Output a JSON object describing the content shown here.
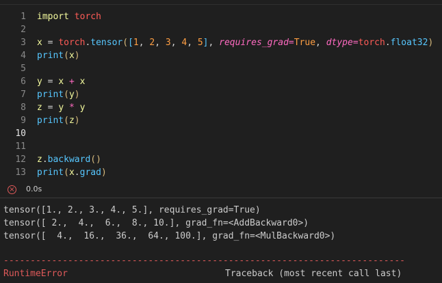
{
  "code_cell": {
    "lines": [
      {
        "num": "1",
        "tokens": [
          {
            "t": "import ",
            "c": "kw"
          },
          {
            "t": "torch",
            "c": "mod"
          }
        ]
      },
      {
        "num": "2",
        "tokens": []
      },
      {
        "num": "3",
        "tokens": [
          {
            "t": "x",
            "c": "var"
          },
          {
            "t": " = ",
            "c": "plain"
          },
          {
            "t": "torch",
            "c": "mod"
          },
          {
            "t": ".",
            "c": "plain"
          },
          {
            "t": "tensor",
            "c": "fn"
          },
          {
            "t": "(",
            "c": "br"
          },
          {
            "t": "[",
            "c": "fn"
          },
          {
            "t": "1",
            "c": "num"
          },
          {
            "t": ", ",
            "c": "plain"
          },
          {
            "t": "2",
            "c": "num"
          },
          {
            "t": ", ",
            "c": "plain"
          },
          {
            "t": "3",
            "c": "num"
          },
          {
            "t": ", ",
            "c": "plain"
          },
          {
            "t": "4",
            "c": "num"
          },
          {
            "t": ", ",
            "c": "plain"
          },
          {
            "t": "5",
            "c": "num"
          },
          {
            "t": "]",
            "c": "fn"
          },
          {
            "t": ", ",
            "c": "plain"
          },
          {
            "t": "requires_grad",
            "c": "param"
          },
          {
            "t": "=",
            "c": "op"
          },
          {
            "t": "True",
            "c": "cst"
          },
          {
            "t": ", ",
            "c": "plain"
          },
          {
            "t": "dtype",
            "c": "param"
          },
          {
            "t": "=",
            "c": "op"
          },
          {
            "t": "torch",
            "c": "mod"
          },
          {
            "t": ".",
            "c": "plain"
          },
          {
            "t": "float32",
            "c": "fn"
          },
          {
            "t": ")",
            "c": "br"
          }
        ]
      },
      {
        "num": "4",
        "tokens": [
          {
            "t": "print",
            "c": "fn"
          },
          {
            "t": "(",
            "c": "br"
          },
          {
            "t": "x",
            "c": "var"
          },
          {
            "t": ")",
            "c": "br"
          }
        ]
      },
      {
        "num": "5",
        "tokens": []
      },
      {
        "num": "6",
        "tokens": [
          {
            "t": "y",
            "c": "var"
          },
          {
            "t": " = ",
            "c": "plain"
          },
          {
            "t": "x",
            "c": "var"
          },
          {
            "t": " + ",
            "c": "op"
          },
          {
            "t": "x",
            "c": "var"
          }
        ]
      },
      {
        "num": "7",
        "tokens": [
          {
            "t": "print",
            "c": "fn"
          },
          {
            "t": "(",
            "c": "br"
          },
          {
            "t": "y",
            "c": "var"
          },
          {
            "t": ")",
            "c": "br"
          }
        ]
      },
      {
        "num": "8",
        "tokens": [
          {
            "t": "z",
            "c": "var"
          },
          {
            "t": " = ",
            "c": "plain"
          },
          {
            "t": "y",
            "c": "var"
          },
          {
            "t": " * ",
            "c": "op"
          },
          {
            "t": "y",
            "c": "var"
          }
        ]
      },
      {
        "num": "9",
        "tokens": [
          {
            "t": "print",
            "c": "fn"
          },
          {
            "t": "(",
            "c": "br"
          },
          {
            "t": "z",
            "c": "var"
          },
          {
            "t": ")",
            "c": "br"
          }
        ]
      },
      {
        "num": "10",
        "tokens": [],
        "active": true
      },
      {
        "num": "11",
        "tokens": []
      },
      {
        "num": "12",
        "tokens": [
          {
            "t": "z",
            "c": "var"
          },
          {
            "t": ".",
            "c": "plain"
          },
          {
            "t": "backward",
            "c": "fn"
          },
          {
            "t": "()",
            "c": "br"
          }
        ]
      },
      {
        "num": "13",
        "tokens": [
          {
            "t": "print",
            "c": "fn"
          },
          {
            "t": "(",
            "c": "br"
          },
          {
            "t": "x",
            "c": "var"
          },
          {
            "t": ".",
            "c": "plain"
          },
          {
            "t": "grad",
            "c": "fn"
          },
          {
            "t": ")",
            "c": "br"
          }
        ]
      }
    ]
  },
  "status": {
    "icon": "error-circle-x-icon",
    "time": "0.0s"
  },
  "output": {
    "lines": [
      "tensor([1., 2., 3., 4., 5.], requires_grad=True)",
      "tensor([ 2.,  4.,  6.,  8., 10.], grad_fn=<AddBackward0>)",
      "tensor([  4.,  16.,  36.,  64., 100.], grad_fn=<MulBackward0>)"
    ],
    "error_dashes": "---------------------------------------------------------------------------",
    "error_name": "RuntimeError",
    "traceback_label": "Traceback (most recent call last)"
  },
  "colors": {
    "background": "#1f1f1f",
    "error": "#e05a5a"
  }
}
